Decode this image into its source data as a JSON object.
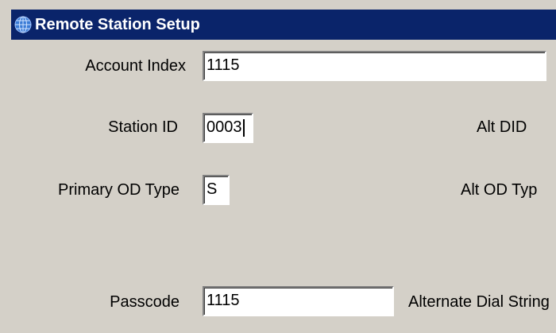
{
  "window": {
    "title": "Remote Station Setup",
    "title_icon": "globe-icon",
    "title_bar_color": "#0a246a"
  },
  "form": {
    "account_index": {
      "label": "Account Index",
      "value": "1115"
    },
    "station_id": {
      "label": "Station ID",
      "value": "0003"
    },
    "primary_od_type": {
      "label": "Primary OD Type",
      "value": "S"
    },
    "passcode": {
      "label": "Passcode",
      "value": "1115"
    },
    "alt_did": {
      "label": "Alt DID"
    },
    "alt_od_type": {
      "label": "Alt OD Typ"
    },
    "alternate_dial_string": {
      "label": "Alternate Dial String"
    }
  }
}
